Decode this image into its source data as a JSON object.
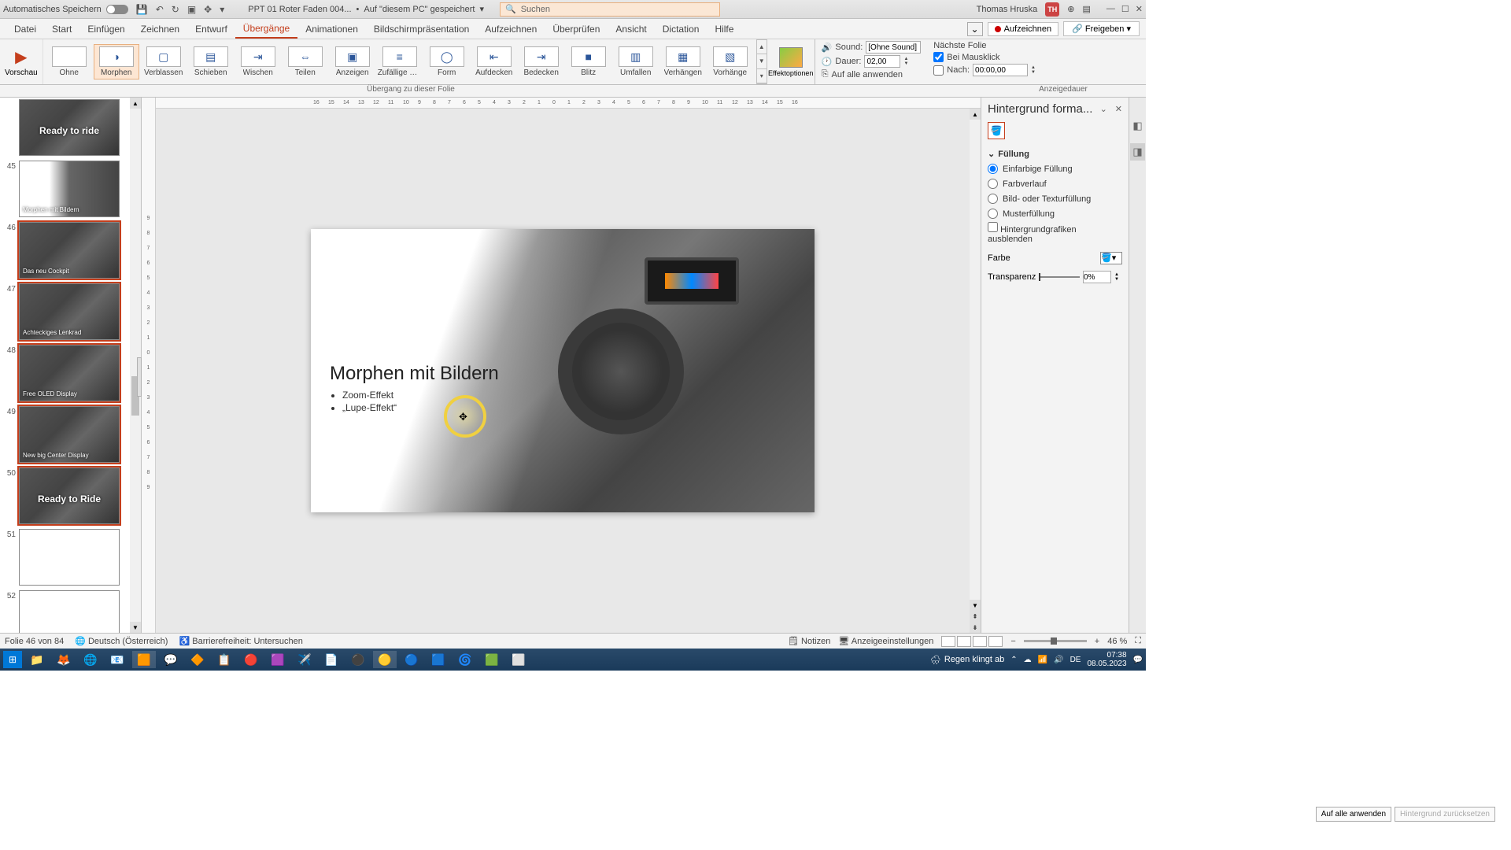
{
  "titlebar": {
    "autosave_label": "Automatisches Speichern",
    "doc_name": "PPT 01 Roter Faden 004...",
    "save_location": "Auf \"diesem PC\" gespeichert",
    "search_placeholder": "Suchen",
    "user_name": "Thomas Hruska",
    "user_initials": "TH"
  },
  "ribbon_tabs": [
    "Datei",
    "Start",
    "Einfügen",
    "Zeichnen",
    "Entwurf",
    "Übergänge",
    "Animationen",
    "Bildschirmpräsentation",
    "Aufzeichnen",
    "Überprüfen",
    "Ansicht",
    "Dictation",
    "Hilfe"
  ],
  "active_tab_index": 5,
  "ribbon_right": {
    "record": "Aufzeichnen",
    "share": "Freigeben"
  },
  "preview_label": "Vorschau",
  "transitions": [
    {
      "label": "Ohne",
      "glyph": ""
    },
    {
      "label": "Morphen",
      "glyph": "◑",
      "selected": true
    },
    {
      "label": "Verblassen",
      "glyph": "▢"
    },
    {
      "label": "Schieben",
      "glyph": "▤"
    },
    {
      "label": "Wischen",
      "glyph": "⇥"
    },
    {
      "label": "Teilen",
      "glyph": "⇔"
    },
    {
      "label": "Anzeigen",
      "glyph": "▣"
    },
    {
      "label": "Zufällige Ba...",
      "glyph": "≡"
    },
    {
      "label": "Form",
      "glyph": "◯"
    },
    {
      "label": "Aufdecken",
      "glyph": "⇤"
    },
    {
      "label": "Bedecken",
      "glyph": "⇥"
    },
    {
      "label": "Blitz",
      "glyph": "■"
    },
    {
      "label": "Umfallen",
      "glyph": "▥"
    },
    {
      "label": "Verhängen",
      "glyph": "▦"
    },
    {
      "label": "Vorhänge",
      "glyph": "▧"
    }
  ],
  "effect_options": "Effektoptionen",
  "gallery_caption": "Übergang zu dieser Folie",
  "timing": {
    "sound_label": "Sound:",
    "sound_value": "[Ohne Sound]",
    "duration_label": "Dauer:",
    "duration_value": "02,00",
    "apply_all": "Auf alle anwenden",
    "group_label": "Anzeigedauer"
  },
  "advance": {
    "title": "Nächste Folie",
    "on_click": "Bei Mausklick",
    "on_click_checked": true,
    "after": "Nach:",
    "after_checked": false,
    "after_value": "00:00,00"
  },
  "ruler_h": [
    "16",
    "15",
    "14",
    "13",
    "12",
    "11",
    "10",
    "9",
    "8",
    "7",
    "6",
    "5",
    "4",
    "3",
    "2",
    "1",
    "0",
    "1",
    "2",
    "3",
    "4",
    "5",
    "6",
    "7",
    "8",
    "9",
    "10",
    "11",
    "12",
    "13",
    "14",
    "15",
    "16"
  ],
  "ruler_v": [
    "9",
    "8",
    "7",
    "6",
    "5",
    "4",
    "3",
    "2",
    "1",
    "0",
    "1",
    "2",
    "3",
    "4",
    "5",
    "6",
    "7",
    "8",
    "9"
  ],
  "thumbnails": [
    {
      "num": "",
      "caption": "Ready to ride",
      "cls": "thumb-dash",
      "big": true
    },
    {
      "num": "45",
      "caption": "Morphen mit Bildern",
      "cls": "thumb-dash2"
    },
    {
      "num": "46",
      "caption": "Das neu Cockpit",
      "cls": "thumb-dash",
      "selected": true
    },
    {
      "num": "47",
      "caption": "Achteckiges Lenkrad",
      "cls": "thumb-dash",
      "selected": true
    },
    {
      "num": "48",
      "caption": "Free OLED Display",
      "cls": "thumb-dash",
      "selected": true
    },
    {
      "num": "49",
      "caption": "New big Center Display",
      "cls": "thumb-dash",
      "selected": true
    },
    {
      "num": "50",
      "caption": "Ready to Ride",
      "cls": "thumb-dash",
      "big": true,
      "selected": true
    },
    {
      "num": "51",
      "caption": "",
      "cls": "blank"
    },
    {
      "num": "52",
      "caption": "",
      "cls": "blank"
    }
  ],
  "slide": {
    "title": "Morphen mit Bildern",
    "bullets": [
      "Zoom-Effekt",
      "„Lupe-Effekt“"
    ]
  },
  "rpane": {
    "title": "Hintergrund forma...",
    "section": "Füllung",
    "fills": [
      {
        "label": "Einfarbige Füllung",
        "checked": true
      },
      {
        "label": "Farbverlauf",
        "checked": false
      },
      {
        "label": "Bild- oder Texturfüllung",
        "checked": false
      },
      {
        "label": "Musterfüllung",
        "checked": false
      }
    ],
    "hide_bg": "Hintergrundgrafiken ausblenden",
    "color_label": "Farbe",
    "transparency_label": "Transparenz",
    "transparency_value": "0%",
    "apply_all": "Auf alle anwenden",
    "reset": "Hintergrund zurücksetzen"
  },
  "status": {
    "slide_of": "Folie 46 von 84",
    "language": "Deutsch (Österreich)",
    "accessibility": "Barrierefreiheit: Untersuchen",
    "notes": "Notizen",
    "display_settings": "Anzeigeeinstellungen",
    "zoom": "46 %"
  },
  "taskbar": {
    "weather": "Regen klingt ab",
    "time": "07:38",
    "date": "08.05.2023"
  }
}
